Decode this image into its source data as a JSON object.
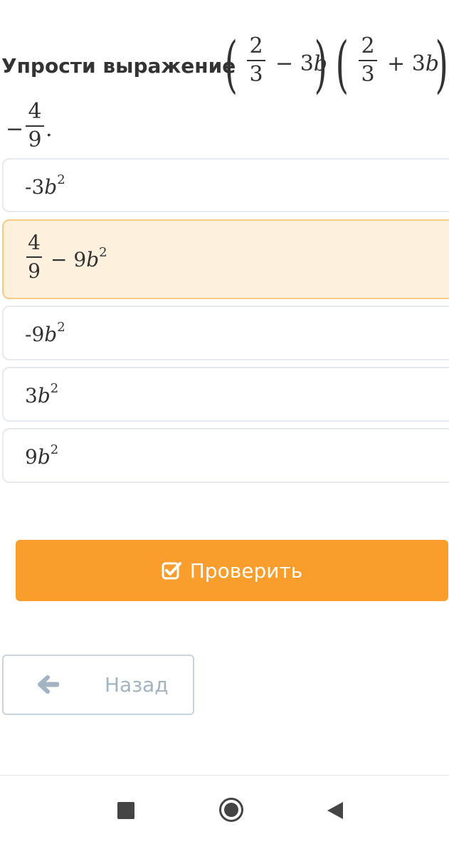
{
  "question": {
    "prompt": "Упрости выражение",
    "frac1": {
      "num": "2",
      "den": "3"
    },
    "term1_op": "−",
    "term1_coef": "3",
    "term1_var": "b",
    "frac2": {
      "num": "2",
      "den": "3"
    },
    "term2_op": "+",
    "term2_coef": "3",
    "term2_var": "b",
    "line2_op": "−",
    "frac3": {
      "num": "4",
      "den": "9"
    },
    "line2_end": "."
  },
  "options": [
    {
      "prefix": "-3",
      "var": "b",
      "exp": "2",
      "selected": false
    },
    {
      "frac_num": "4",
      "frac_den": "9",
      "op": "−",
      "coef": "9",
      "var": "b",
      "exp": "2",
      "selected": true
    },
    {
      "prefix": "-9",
      "var": "b",
      "exp": "2",
      "selected": false
    },
    {
      "prefix": "3",
      "var": "b",
      "exp": "2",
      "selected": false
    },
    {
      "prefix": "9",
      "var": "b",
      "exp": "2",
      "selected": false
    }
  ],
  "check_button": {
    "label": "Проверить",
    "icon": "check-square-icon",
    "color": "#f99e2c"
  },
  "back_button": {
    "label": "Назад",
    "icon": "arrow-left-icon"
  },
  "navbar": {
    "items": [
      "stop-square-icon",
      "home-circle-icon",
      "back-triangle-icon"
    ]
  }
}
